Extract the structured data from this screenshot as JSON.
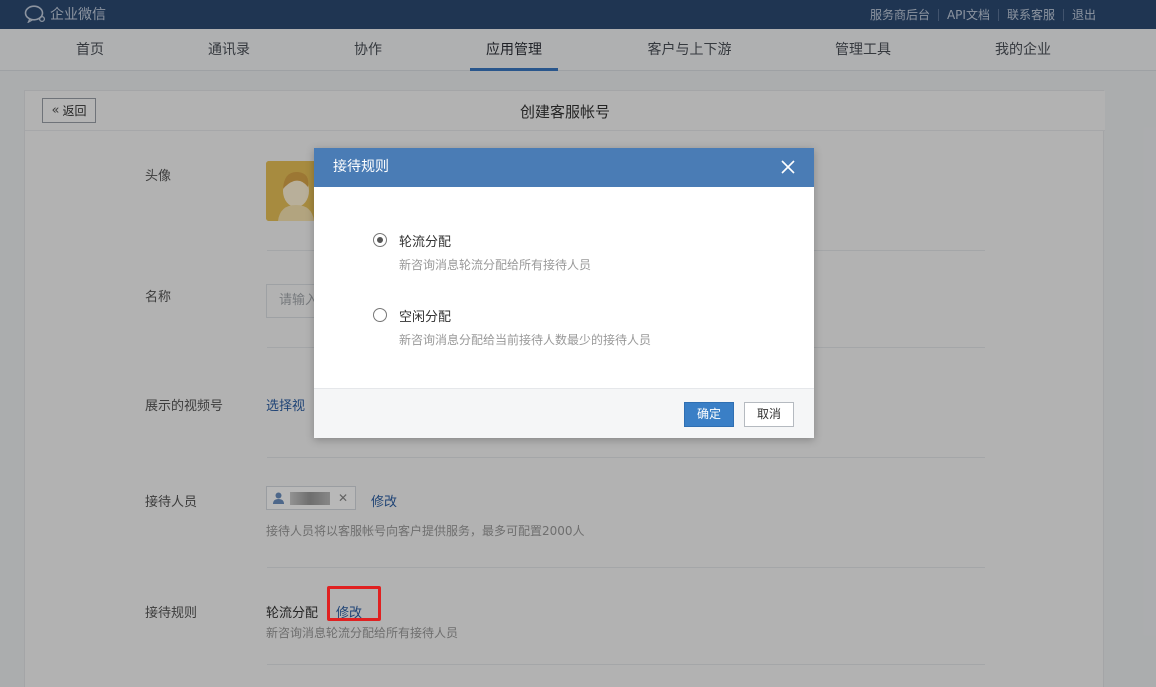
{
  "topbar": {
    "logo_text": "企业微信",
    "links": [
      "服务商后台",
      "API文档",
      "联系客服",
      "退出"
    ]
  },
  "nav": {
    "items": [
      "首页",
      "通讯录",
      "协作",
      "应用管理",
      "客户与上下游",
      "管理工具",
      "我的企业"
    ],
    "active": "应用管理"
  },
  "page": {
    "back_label": "返回",
    "title": "创建客服帐号"
  },
  "form": {
    "avatar_label": "头像",
    "name_label": "名称",
    "name_placeholder": "请输入",
    "video_label": "展示的视频号",
    "video_link": "选择视",
    "staff_label": "接待人员",
    "staff_edit": "修改",
    "staff_hint": "接待人员将以客服帐号向客户提供服务，最多可配置2000人",
    "rule_label": "接待规则",
    "rule_value": "轮流分配",
    "rule_edit": "修改",
    "rule_hint": "新咨询消息轮流分配给所有接待人员"
  },
  "dialog": {
    "title": "接待规则",
    "options": [
      {
        "title": "轮流分配",
        "desc": "新咨询消息轮流分配给所有接待人员",
        "checked": true
      },
      {
        "title": "空闲分配",
        "desc": "新咨询消息分配给当前接待人数最少的接待人员",
        "checked": false
      }
    ],
    "ok_label": "确定",
    "cancel_label": "取消"
  },
  "colors": {
    "topbar": "#2c4a72",
    "dialog_header": "#4a7cb5",
    "primary_button": "#3a7fc6",
    "link": "#2b5ea3",
    "highlight": "#e02020"
  }
}
